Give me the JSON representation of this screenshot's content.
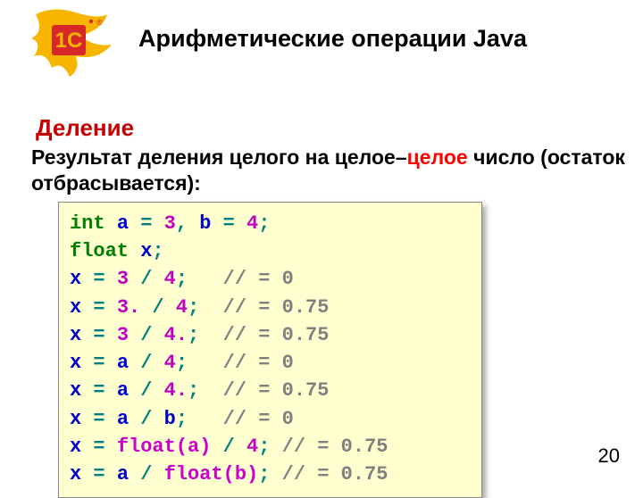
{
  "title": "Арифметические операции Java",
  "subtitle": "Деление",
  "desc": {
    "part1": "Результат деления целого на целое–",
    "highlight": "целое",
    "part2": " число (остаток отбрасывается):"
  },
  "code": {
    "l1": {
      "kw": "int",
      "id1": "a",
      "eq": " = ",
      "n1": "3",
      "comma": ", ",
      "id2": "b",
      "eq2": " = ",
      "n2": "4",
      "semi": ";"
    },
    "l2": {
      "kw": "float",
      "id": "x",
      "semi": ";"
    },
    "l3": {
      "id": "x",
      "eq": " = ",
      "n1": "3",
      "div": " / ",
      "n2": "4",
      "semi": ";",
      "pad": "   ",
      "cmt": "// = 0"
    },
    "l4": {
      "id": "x",
      "eq": " = ",
      "n1": "3.",
      "div": " / ",
      "n2": "4",
      "semi": ";",
      "pad": "  ",
      "cmt": "// = 0.75"
    },
    "l5": {
      "id": "x",
      "eq": " = ",
      "n1": "3",
      "div": " / ",
      "n2": "4.",
      "semi": ";",
      "pad": "  ",
      "cmt": "// = 0.75"
    },
    "l6": {
      "id": "x",
      "eq": " = ",
      "id2": "a",
      "div": " / ",
      "n2": "4",
      "semi": ";",
      "pad": "   ",
      "cmt": "// = 0"
    },
    "l7": {
      "id": "x",
      "eq": " = ",
      "id2": "a",
      "div": " / ",
      "n2": "4.",
      "semi": ";",
      "pad": "  ",
      "cmt": "// = 0.75"
    },
    "l8": {
      "id": "x",
      "eq": " = ",
      "id2": "a",
      "div": " / ",
      "id3": "b",
      "semi": ";",
      "pad": "   ",
      "cmt": "// = 0"
    },
    "l9": {
      "id": "x",
      "eq": " = ",
      "cast": "float(a)",
      "div": " / ",
      "n2": "4",
      "semi": ";",
      "pad": " ",
      "cmt": "// = 0.75"
    },
    "l10": {
      "id": "x",
      "eq": " = ",
      "id2": "a",
      "div": " / ",
      "cast": "float(b)",
      "semi": ";",
      "pad": " ",
      "cmt": "// = 0.75"
    }
  },
  "pagenum": "20",
  "logo": {
    "brand": "1C"
  }
}
